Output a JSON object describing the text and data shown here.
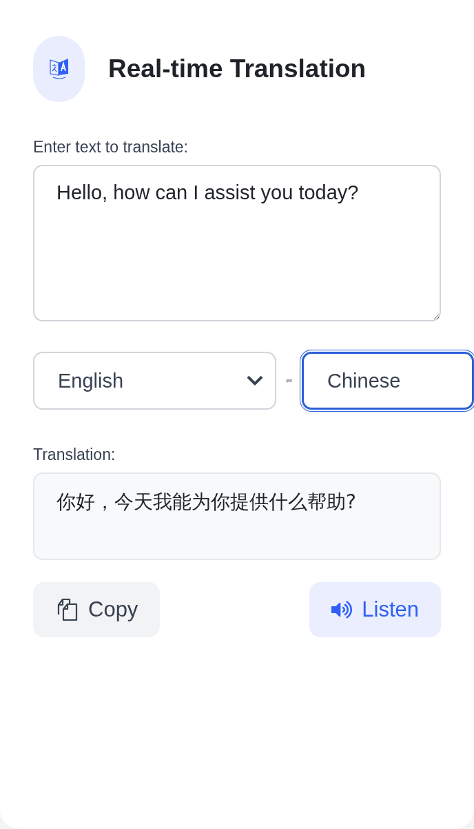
{
  "header": {
    "title": "Real-time Translation"
  },
  "input": {
    "label": "Enter text to translate:",
    "value": "Hello, how can I assist you today?"
  },
  "languages": {
    "source": {
      "value": "English",
      "focused": false
    },
    "target": {
      "value": "Chinese",
      "focused": true
    }
  },
  "output": {
    "label": "Translation:",
    "value": "你好，今天我能为你提供什么帮助?"
  },
  "buttons": [
    {
      "kind": "copy",
      "label": "Copy"
    },
    {
      "kind": "listen",
      "label": "Listen"
    }
  ]
}
